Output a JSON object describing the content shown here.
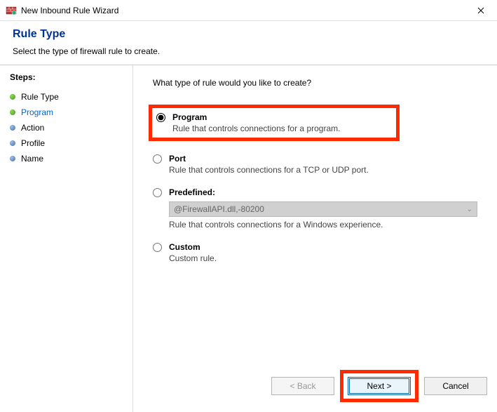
{
  "window": {
    "title": "New Inbound Rule Wizard"
  },
  "header": {
    "title": "Rule Type",
    "subtitle": "Select the type of firewall rule to create."
  },
  "sidebar": {
    "stepsLabel": "Steps:",
    "steps": [
      {
        "label": "Rule Type",
        "state": "done"
      },
      {
        "label": "Program",
        "state": "active"
      },
      {
        "label": "Action",
        "state": "pending"
      },
      {
        "label": "Profile",
        "state": "pending"
      },
      {
        "label": "Name",
        "state": "pending"
      }
    ]
  },
  "main": {
    "question": "What type of rule would you like to create?",
    "options": {
      "program": {
        "title": "Program",
        "desc": "Rule that controls connections for a program.",
        "selected": true
      },
      "port": {
        "title": "Port",
        "desc": "Rule that controls connections for a TCP or UDP port.",
        "selected": false
      },
      "predefined": {
        "title": "Predefined:",
        "value": "@FirewallAPI.dll,-80200",
        "desc": "Rule that controls connections for a Windows experience.",
        "selected": false
      },
      "custom": {
        "title": "Custom",
        "desc": "Custom rule.",
        "selected": false
      }
    }
  },
  "footer": {
    "back": "< Back",
    "next": "Next >",
    "cancel": "Cancel"
  }
}
